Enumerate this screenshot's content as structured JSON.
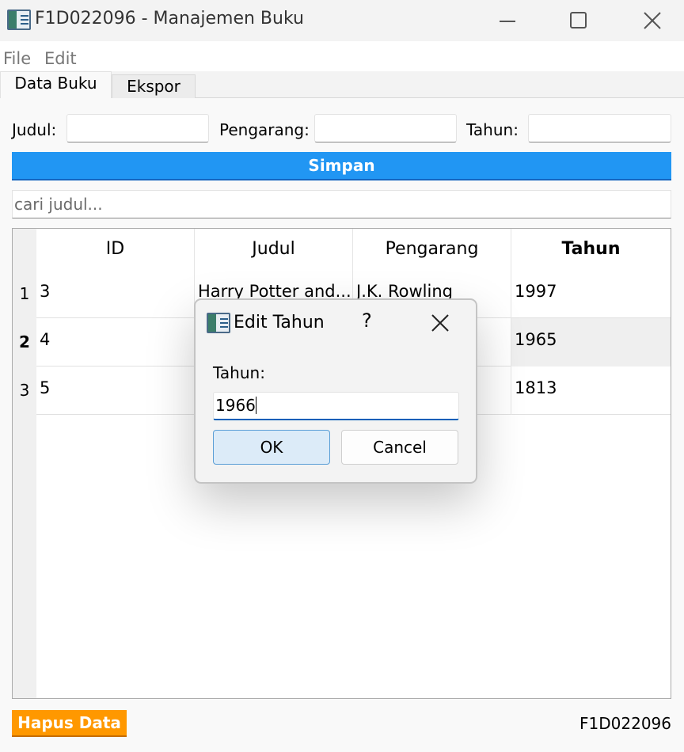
{
  "window": {
    "title": "F1D022096 - Manajemen Buku"
  },
  "menu": {
    "file": "File",
    "edit": "Edit"
  },
  "tabs": [
    {
      "label": "Data Buku",
      "active": true
    },
    {
      "label": "Ekspor",
      "active": false
    }
  ],
  "form": {
    "judul_label": "Judul:",
    "judul_value": "",
    "pengarang_label": "Pengarang:",
    "pengarang_value": "",
    "tahun_label": "Tahun:",
    "tahun_value": "",
    "save_label": "Simpan"
  },
  "search": {
    "placeholder": "cari judul..."
  },
  "table": {
    "columns": [
      "ID",
      "Judul",
      "Pengarang",
      "Tahun"
    ],
    "sorted_column": "Tahun",
    "rows": [
      {
        "index": "1",
        "id": "3",
        "judul": "Harry Potter and...",
        "pengarang": "J.K. Rowling",
        "tahun": "1997",
        "selected": false
      },
      {
        "index": "2",
        "id": "4",
        "judul": "",
        "pengarang": "",
        "tahun": "1965",
        "selected": true
      },
      {
        "index": "3",
        "id": "5",
        "judul": "",
        "pengarang": "",
        "tahun": "1813",
        "selected": false
      }
    ]
  },
  "footer": {
    "delete_label": "Hapus Data",
    "student_id": "F1D022096"
  },
  "dialog": {
    "title": "Edit Tahun",
    "help": "?",
    "label": "Tahun:",
    "value": "1966",
    "ok_label": "OK",
    "cancel_label": "Cancel"
  },
  "colors": {
    "save_button": "#2196f3",
    "delete_button": "#ff9800",
    "selected_row": "#efefef"
  }
}
